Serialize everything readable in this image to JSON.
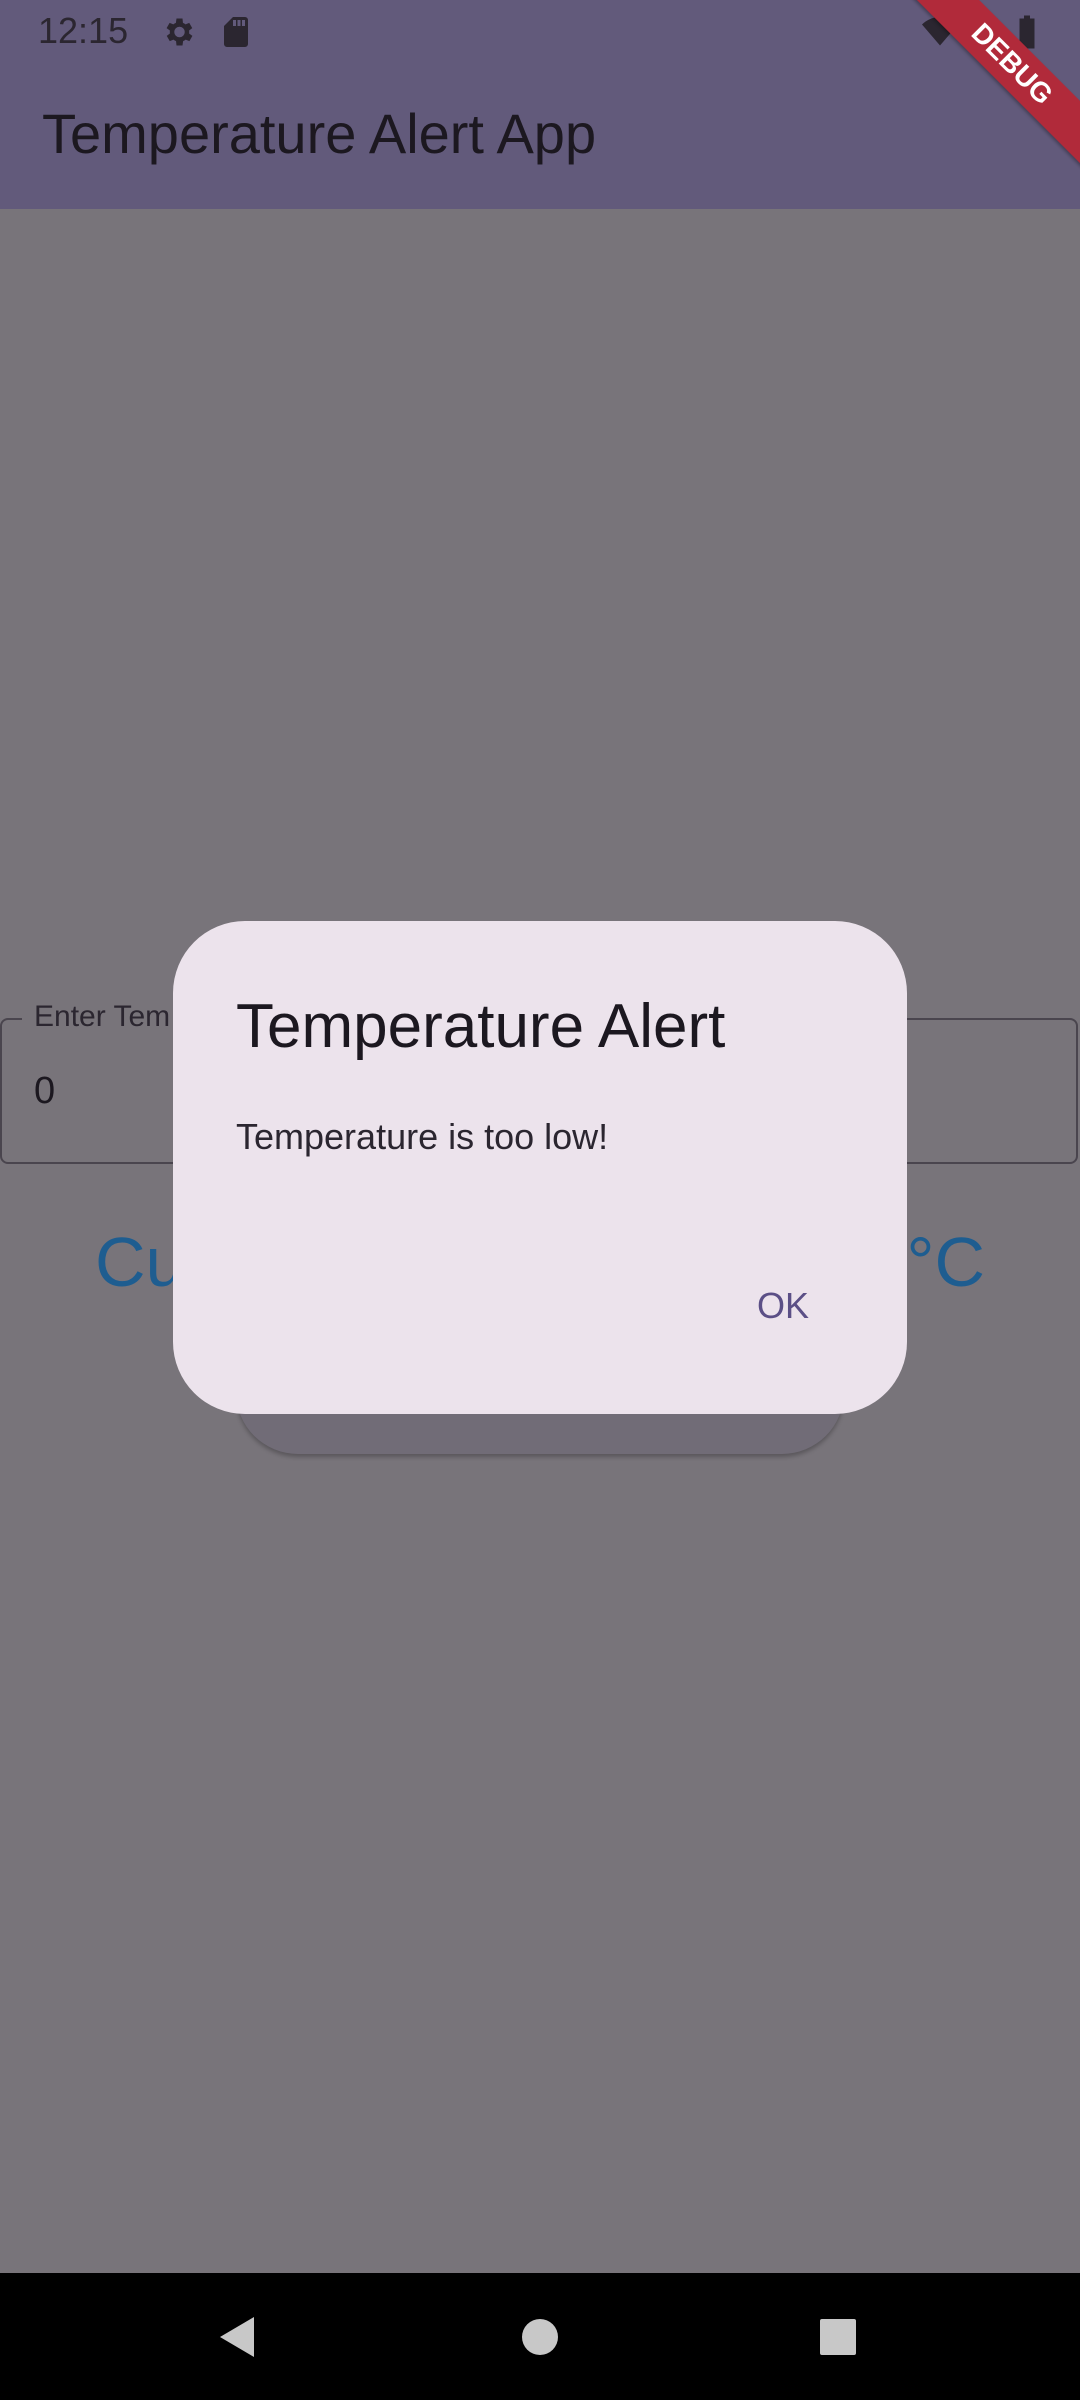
{
  "status_bar": {
    "time": "12:15",
    "icons": [
      "gear-icon",
      "sd-card-icon",
      "wifi-icon",
      "signal-icon",
      "battery-icon"
    ]
  },
  "app_bar": {
    "title": "Temperature Alert App"
  },
  "form": {
    "temperature_label": "Enter Tem",
    "temperature_value": "0",
    "current_temp_prefix": "Cu",
    "current_temp_suffix": "°C"
  },
  "dialog": {
    "title": "Temperature Alert",
    "message": "Temperature is too low!",
    "ok_label": "OK"
  },
  "debug_banner": "DEBUG",
  "nav_bar": {
    "icons": [
      "back-icon",
      "home-icon",
      "recents-icon"
    ]
  },
  "colors": {
    "app_bar": "#625a7b",
    "scrim": "#78747a",
    "dialog_bg": "#ece3ec",
    "accent_text": "#1e5d90",
    "ok_text": "#5b4f86",
    "debug": "#b12a3a"
  }
}
